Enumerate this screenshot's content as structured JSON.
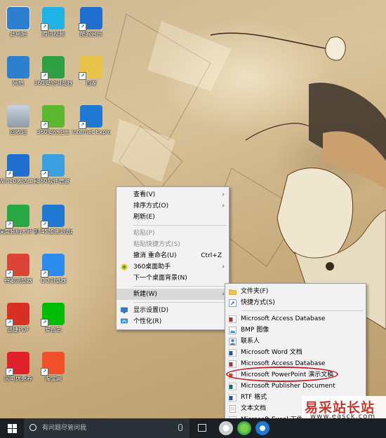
{
  "desktop": {
    "icons": [
      {
        "label": "此电脑",
        "icon": "this-pc-icon",
        "color": "#2f7fd1"
      },
      {
        "label": "腾讯视频",
        "icon": "tencent-video-icon",
        "color": "#1fb3e8"
      },
      {
        "label": "酷狗音乐",
        "icon": "kugou-music-icon",
        "color": "#1f6fd1"
      },
      {
        "label": "网络",
        "icon": "network-icon",
        "color": "#2f7fd1"
      },
      {
        "label": "360安全浏览器",
        "icon": "360-browser-icon",
        "color": "#2ea043"
      },
      {
        "label": "百家",
        "icon": "folder-icon",
        "color": "#e8c34a"
      },
      {
        "label": "回收站",
        "icon": "recycle-bin-icon",
        "color": "#9aa9b8"
      },
      {
        "label": "360安全卫士",
        "icon": "360-safe-icon",
        "color": "#5cb82e"
      },
      {
        "label": "Internet Explorer",
        "icon": "ie-icon",
        "color": "#1f78d1"
      },
      {
        "label": "Win10激活工具(慎装...",
        "icon": "windows-icon",
        "color": "#1e6fd0"
      },
      {
        "label": "360软件管家",
        "icon": "360-soft-icon",
        "color": "#3aa0e0"
      },
      {
        "label": "深度装机大师 56",
        "icon": "deepin-installer-icon",
        "color": "#28a745"
      },
      {
        "label": "2345加速浏览器",
        "icon": "2345-browser-icon",
        "color": "#1f78d1"
      },
      {
        "label": "谷歌浏览器",
        "icon": "chrome-icon",
        "color": "#db4437"
      },
      {
        "label": "QQ浏览器",
        "icon": "qq-browser-icon",
        "color": "#2d8cf0"
      },
      {
        "label": "迅捷PDF",
        "icon": "pdf-icon",
        "color": "#d93025"
      },
      {
        "label": "爱奇艺",
        "icon": "iqiyi-icon",
        "color": "#00be06"
      },
      {
        "label": "闪电优惠券",
        "icon": "coupon-icon",
        "color": "#e0202a"
      },
      {
        "label": "淘宝网",
        "icon": "taobao-icon",
        "color": "#f2502a"
      }
    ]
  },
  "context_menu": {
    "items": [
      {
        "label": "查看(V)",
        "submenu": true
      },
      {
        "label": "排序方式(O)",
        "submenu": true
      },
      {
        "label": "刷新(E)"
      },
      {
        "label": "粘贴(P)",
        "disabled": true
      },
      {
        "label": "粘贴快捷方式(S)",
        "disabled": true
      },
      {
        "label": "撤消 重命名(U)",
        "accel": "Ctrl+Z"
      },
      {
        "label": "360桌面助手",
        "submenu": true
      },
      {
        "label": "下一个桌面背景(N)"
      },
      {
        "label": "新建(W)",
        "submenu": true,
        "active": true
      },
      {
        "label": "显示设置(D)"
      },
      {
        "label": "个性化(R)"
      }
    ]
  },
  "new_submenu": {
    "items": [
      {
        "label": "文件夹(F)",
        "icon": "folder-icon"
      },
      {
        "label": "快捷方式(S)",
        "icon": "shortcut-icon"
      },
      {
        "label": "Microsoft Access Database",
        "icon": "access-icon"
      },
      {
        "label": "BMP 图像",
        "icon": "bmp-image-icon"
      },
      {
        "label": "联系人",
        "icon": "contact-icon"
      },
      {
        "label": "Microsoft Word 文档",
        "icon": "word-icon"
      },
      {
        "label": "Microsoft Access Database",
        "icon": "access-icon"
      },
      {
        "label": "Microsoft PowerPoint 演示文稿",
        "icon": "powerpoint-icon"
      },
      {
        "label": "Microsoft Publisher Document",
        "icon": "publisher-icon"
      },
      {
        "label": "RTF 格式",
        "icon": "rtf-icon"
      },
      {
        "label": "文本文档",
        "icon": "text-document-icon"
      },
      {
        "label": "Microsoft Excel 工作表",
        "icon": "excel-icon"
      }
    ]
  },
  "taskbar": {
    "search_placeholder": "有问题尽管问我"
  },
  "watermark": {
    "title": "易采站长站",
    "url": "www.easck.com"
  },
  "colors": {
    "menu_bg": "#f2f2f2",
    "taskbar_bg": "#1a1f24",
    "highlight": "#c0202a"
  }
}
